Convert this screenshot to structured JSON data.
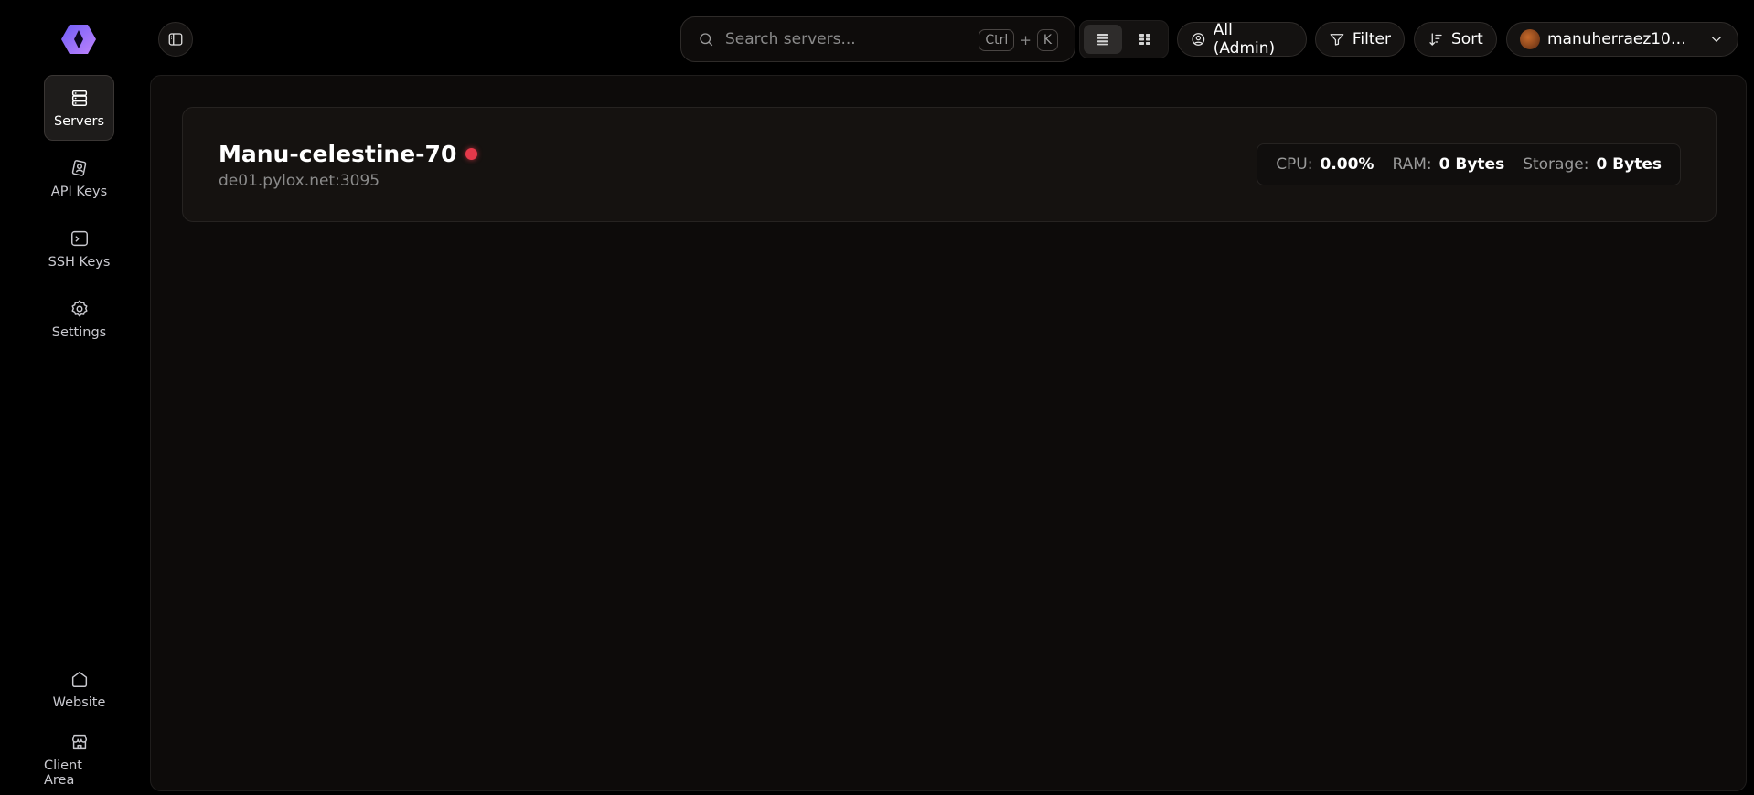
{
  "sidebar": {
    "items": [
      {
        "label": "Servers",
        "icon": "servers-icon",
        "active": true
      },
      {
        "label": "API Keys",
        "icon": "api-key-icon"
      },
      {
        "label": "SSH Keys",
        "icon": "terminal-icon"
      },
      {
        "label": "Settings",
        "icon": "gear-icon"
      }
    ],
    "bottom_items": [
      {
        "label": "Website",
        "icon": "home-icon"
      },
      {
        "label": "Client Area",
        "icon": "store-icon"
      }
    ]
  },
  "topbar": {
    "search_placeholder": "Search servers...",
    "shortcut_key1": "Ctrl",
    "shortcut_plus": "+",
    "shortcut_key2": "K",
    "admin_label": "All (Admin)",
    "filter_label": "Filter",
    "sort_label": "Sort",
    "user_label": "manuherraez10@h..."
  },
  "servers": [
    {
      "name": "Manu-celestine-70",
      "address": "de01.pylox.net:3095",
      "status_color": "#e5394a",
      "cpu_label": "CPU:",
      "cpu_value": "0.00%",
      "ram_label": "RAM:",
      "ram_value": "0 Bytes",
      "storage_label": "Storage:",
      "storage_value": "0 Bytes"
    }
  ],
  "colors": {
    "background": "#000000",
    "panel": "#0d0b0a",
    "card": "#151210",
    "accent_logo": "#8b5cf6"
  }
}
